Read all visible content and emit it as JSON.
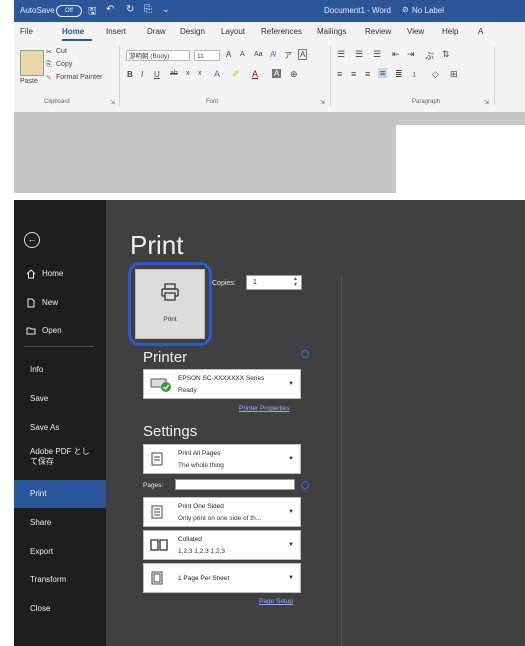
{
  "ribbon_window": {
    "titlebar": {
      "autosave_label": "AutoSave",
      "autosave_state": "Off",
      "document_title": "Document1 - Word",
      "label_status": "No Label"
    },
    "tabs": [
      {
        "label": "File"
      },
      {
        "label": "Home"
      },
      {
        "label": "Insert"
      },
      {
        "label": "Draw"
      },
      {
        "label": "Design"
      },
      {
        "label": "Layout"
      },
      {
        "label": "References"
      },
      {
        "label": "Mailings"
      },
      {
        "label": "Review"
      },
      {
        "label": "View"
      },
      {
        "label": "Help"
      },
      {
        "label": "A"
      }
    ],
    "active_tab": "Home",
    "clipboard": {
      "paste_label": "Paste",
      "cut_label": "Cut",
      "copy_label": "Copy",
      "format_painter_label": "Format Painter",
      "group_label": "Clipboard"
    },
    "font": {
      "font_name": "游明朝 (Body)",
      "font_size": "11",
      "grow_font": "A",
      "shrink_font": "A",
      "change_case": "Aa",
      "bold": "B",
      "italic": "I",
      "underline": "U",
      "strikethrough": "ab",
      "subscript": "x",
      "superscript": "x",
      "group_label": "Font"
    },
    "paragraph": {
      "group_label": "Paragraph"
    }
  },
  "backstage": {
    "nav": [
      {
        "label": "Home",
        "icon": "home-icon"
      },
      {
        "label": "New",
        "icon": "new-document-icon"
      },
      {
        "label": "Open",
        "icon": "folder-open-icon"
      },
      {
        "label": "Info"
      },
      {
        "label": "Save"
      },
      {
        "label": "Save As"
      },
      {
        "label": "Adobe PDF として保存"
      },
      {
        "label": "Print",
        "selected": true
      },
      {
        "label": "Share"
      },
      {
        "label": "Export"
      },
      {
        "label": "Transform"
      },
      {
        "label": "Close"
      }
    ],
    "print": {
      "title": "Print",
      "print_button_label": "Print",
      "copies_label": "Copies:",
      "copies_value": "1",
      "printer_section": "Printer",
      "printer_name": "EPSON SC-XXXXXXX Series",
      "printer_status": "Ready",
      "printer_properties_link": "Printer Properties",
      "settings_section": "Settings",
      "settings": [
        {
          "line1": "Print All Pages",
          "line2": "The whole thing",
          "icon": "pages-icon"
        },
        {
          "line1": "Print One Sided",
          "line2": "Only print on one side of th...",
          "icon": "one-sided-icon"
        },
        {
          "line1": "Collated",
          "line2": "1,2,3   1,2,3   1,2,3",
          "icon": "collated-icon"
        },
        {
          "line1": "1 Page Per Sheet",
          "line2": "",
          "icon": "page-per-sheet-icon"
        }
      ],
      "pages_label": "Pages:",
      "page_setup_link": "Page Setup"
    }
  },
  "colors": {
    "word_blue": "#2b579a",
    "highlight_ring": "#2a5bd7",
    "backstage_bg": "#404040",
    "nav_bg": "#1e1e1e"
  }
}
